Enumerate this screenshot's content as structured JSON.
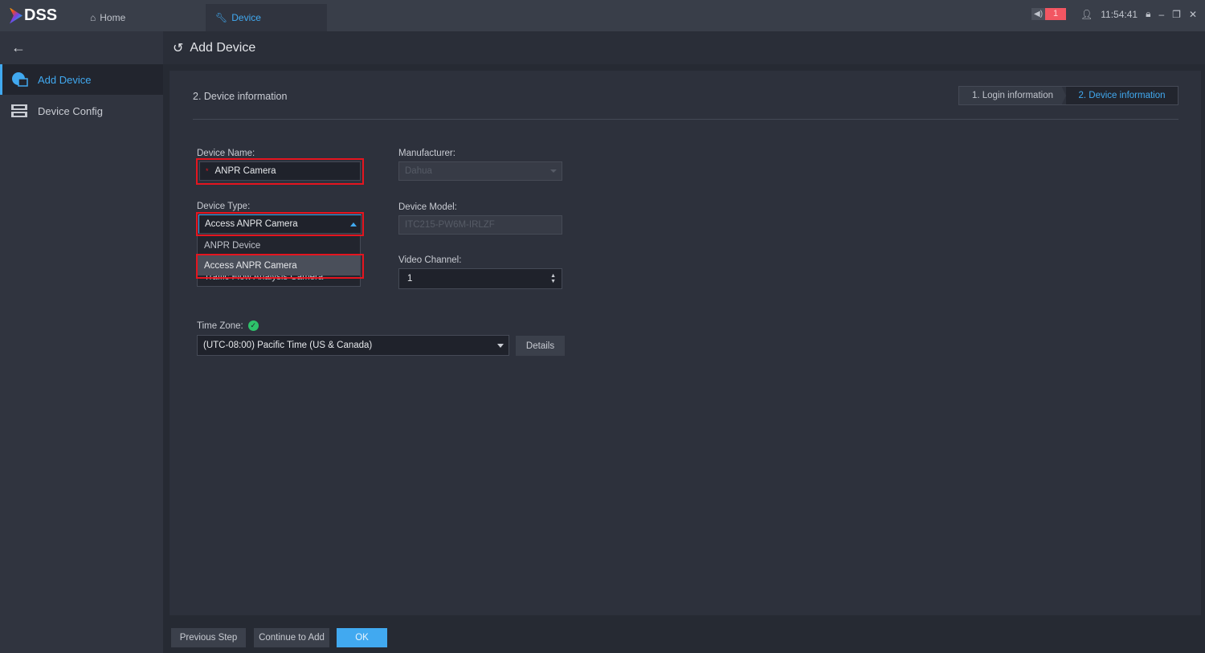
{
  "app": {
    "logo": "DSS",
    "tabs": [
      {
        "label": "Home",
        "icon": "home-icon"
      },
      {
        "label": "Device",
        "icon": "wrench-icon"
      }
    ]
  },
  "system": {
    "alarm_count": "1",
    "time": "11:54:41"
  },
  "sidebar": {
    "items": [
      {
        "label": "Add Device",
        "icon": "add-device-icon",
        "active": true
      },
      {
        "label": "Device Config",
        "icon": "device-config-icon"
      }
    ]
  },
  "header": {
    "title": "Add Device"
  },
  "form": {
    "section_title": "2. Device information",
    "steps": [
      "1. Login information",
      "2. Device information"
    ],
    "device_name": {
      "label": "Device Name:",
      "value": "ANPR Camera",
      "required_mark": "*"
    },
    "device_type": {
      "label": "Device Type:",
      "value": "Access ANPR Camera",
      "options": [
        "ANPR Device",
        "Access ANPR Camera",
        "Traffic Flow Analysis Camera"
      ]
    },
    "manufacturer": {
      "label": "Manufacturer:",
      "value": "Dahua"
    },
    "device_model": {
      "label": "Device Model:",
      "value": "ITC215-PW6M-IRLZF"
    },
    "video_channel": {
      "label": "Video Channel:",
      "value": "1"
    },
    "time_zone": {
      "label": "Time Zone:",
      "value": "(UTC-08:00) Pacific Time (US & Canada)",
      "details": "Details"
    }
  },
  "footer": {
    "previous": "Previous Step",
    "continue": "Continue to Add",
    "ok": "OK"
  },
  "colors": {
    "accent": "#41a9f0",
    "highlight": "#e5151f",
    "alarm": "#f25662",
    "ok": "#2ec26a"
  }
}
